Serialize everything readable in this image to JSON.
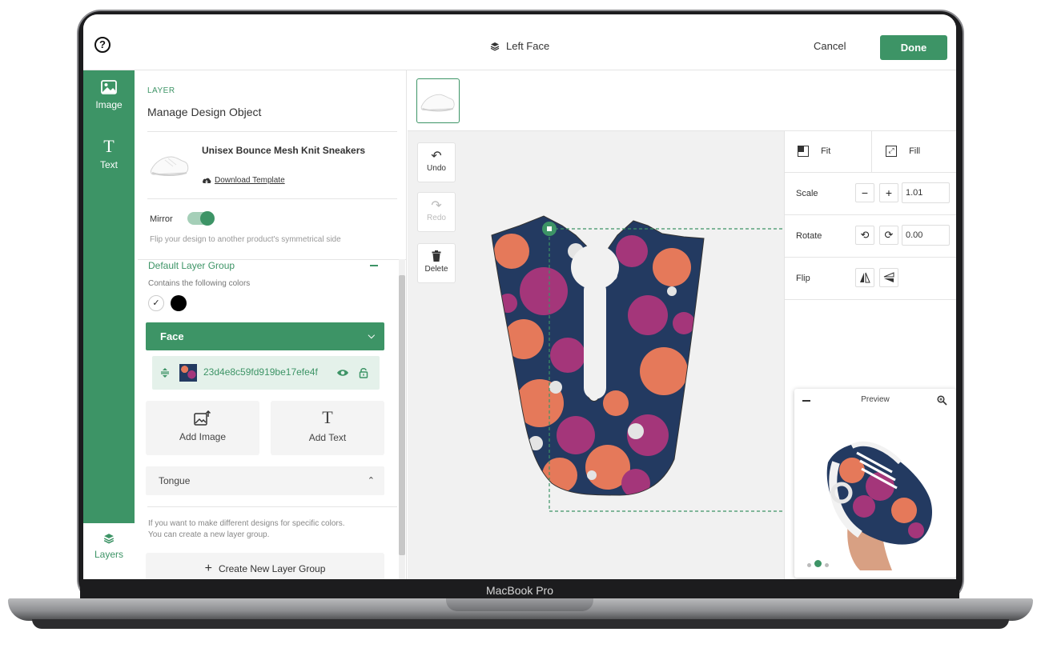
{
  "topbar": {
    "title": "Left Face",
    "cancel_label": "Cancel",
    "done_label": "Done",
    "help_glyph": "?"
  },
  "rail": {
    "items": [
      {
        "label": "Image",
        "icon": "image-icon"
      },
      {
        "label": "Text",
        "icon": "text-icon"
      }
    ],
    "layers_label": "Layers"
  },
  "panel": {
    "section_tag": "LAYER",
    "title": "Manage Design Object",
    "product_name": "Unisex Bounce Mesh Knit Sneakers",
    "download_label": "Download Template",
    "mirror_label": "Mirror",
    "mirror_on": true,
    "mirror_desc": "Flip your design to another product's symmetrical side",
    "group_title": "Default Layer Group",
    "colors_label": "Contains the following colors",
    "face_label": "Face",
    "layer_id": "23d4e8c59fd919be17efe4f",
    "add_image_label": "Add Image",
    "add_text_label": "Add Text",
    "tongue_label": "Tongue",
    "info_line1": "If you want to make different designs for specific colors.",
    "info_line2": "You can create a new layer group.",
    "create_group_label": "Create New Layer Group"
  },
  "tools": {
    "undo": "Undo",
    "redo": "Redo",
    "delete": "Delete"
  },
  "controls": {
    "fit_label": "Fit",
    "fill_label": "Fill",
    "scale_label": "Scale",
    "scale_value": "1.01",
    "rotate_label": "Rotate",
    "rotate_value": "0.00",
    "flip_label": "Flip"
  },
  "preview": {
    "title": "Preview"
  },
  "device": {
    "label": "MacBook Pro"
  },
  "colors": {
    "accent": "#3d9466",
    "pattern_navy": "#233a61",
    "pattern_orange": "#e5795a",
    "pattern_magenta": "#a4367a"
  }
}
